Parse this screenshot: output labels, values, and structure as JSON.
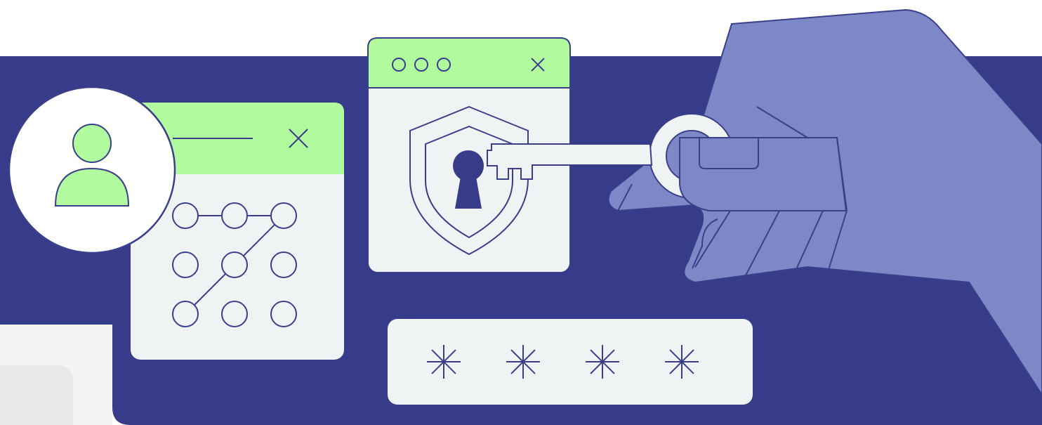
{
  "illustration": {
    "subject": "security-authentication",
    "colors": {
      "background": "#ffffff",
      "navy": "#373C8A",
      "green": "#B2FA9E",
      "panel": "#F0F3F4",
      "hand": "#7D89C7",
      "outline": "#3A3F8C",
      "keyhole": "#373C8A",
      "gray_tile": "#F4F4F4",
      "gray_inner": "#E9E9EA"
    },
    "pattern_lock": {
      "grid_size": 3,
      "drawn_path_nodes": [
        6,
        4,
        2,
        1,
        0
      ]
    },
    "password_field": {
      "masked_chars": 4
    },
    "window_dots": 3
  }
}
